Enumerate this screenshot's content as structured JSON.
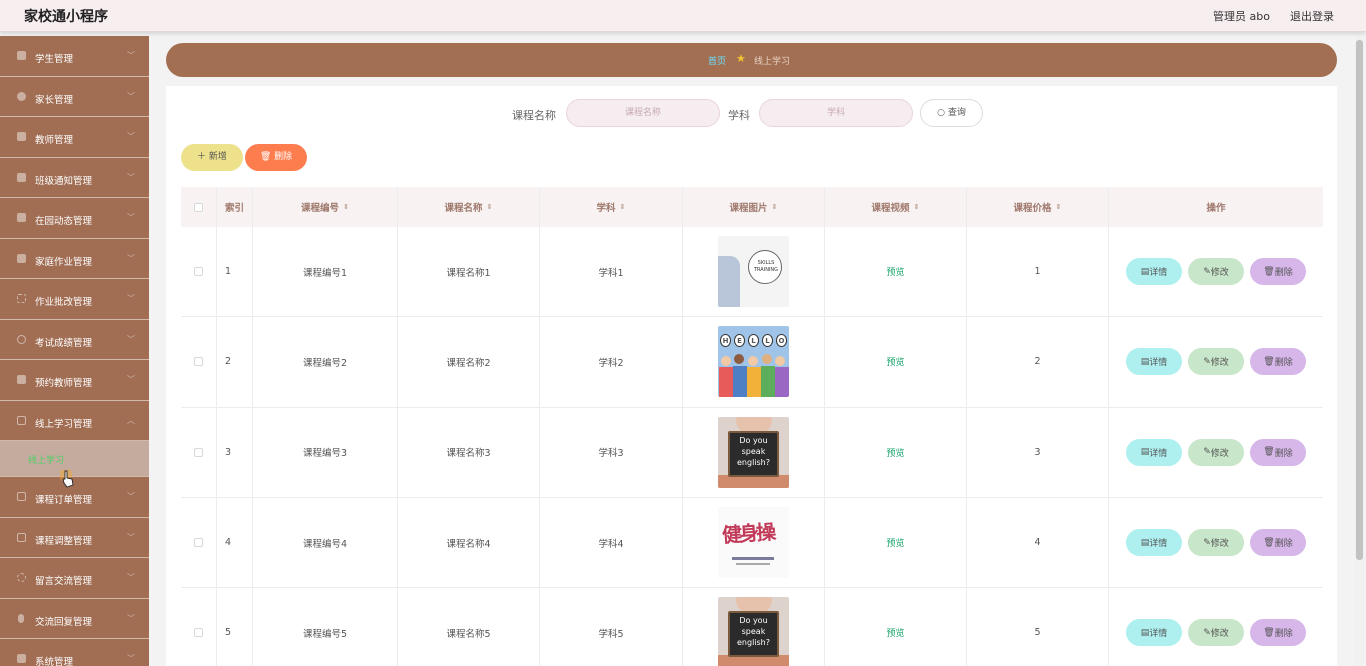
{
  "header": {
    "brand": "家校通小程序",
    "admin_label": "管理员 abo",
    "logout_label": "退出登录"
  },
  "sidebar": {
    "items": [
      {
        "label": "学生管理",
        "icon": "grid-icon"
      },
      {
        "label": "家长管理",
        "icon": "location-icon"
      },
      {
        "label": "教师管理",
        "icon": "chart-icon"
      },
      {
        "label": "班级通知管理",
        "icon": "notice-icon"
      },
      {
        "label": "在园动态管理",
        "icon": "building-icon"
      },
      {
        "label": "家庭作业管理",
        "icon": "puzzle-icon"
      },
      {
        "label": "作业批改管理",
        "icon": "expand-icon"
      },
      {
        "label": "考试成绩管理",
        "icon": "circle-icon"
      },
      {
        "label": "预约教师管理",
        "icon": "list-icon"
      },
      {
        "label": "线上学习管理",
        "icon": "mail-icon"
      }
    ],
    "active_sub": "线上学习",
    "items_after": [
      {
        "label": "课程订单管理",
        "icon": "order-icon"
      },
      {
        "label": "课程调整管理",
        "icon": "crop-icon"
      },
      {
        "label": "留言交流管理",
        "icon": "message-icon"
      },
      {
        "label": "交流回复管理",
        "icon": "mic-icon"
      },
      {
        "label": "系统管理",
        "icon": "settings-icon"
      }
    ]
  },
  "breadcrumb": {
    "home": "首页",
    "current": "线上学习"
  },
  "search": {
    "name_label": "课程名称",
    "name_placeholder": "课程名称",
    "subject_label": "学科",
    "subject_placeholder": "学科",
    "query_label": "查询"
  },
  "toolbar": {
    "add_label": "新增",
    "delete_label": "删除"
  },
  "table": {
    "headers": {
      "index": "索引",
      "code": "课程编号",
      "name": "课程名称",
      "subject": "学科",
      "image": "课程图片",
      "video": "课程视频",
      "price": "课程价格",
      "action": "操作"
    },
    "rows": [
      {
        "index": "1",
        "code": "课程编号1",
        "name": "课程名称1",
        "subject": "学科1",
        "video": "预览",
        "price": "1",
        "thumb": "skill-training"
      },
      {
        "index": "2",
        "code": "课程编号2",
        "name": "课程名称2",
        "subject": "学科2",
        "video": "预览",
        "price": "2",
        "thumb": "hello-kids"
      },
      {
        "index": "3",
        "code": "课程编号3",
        "name": "课程名称3",
        "subject": "学科3",
        "video": "预览",
        "price": "3",
        "thumb": "do-you-speak-english"
      },
      {
        "index": "4",
        "code": "课程编号4",
        "name": "课程名称4",
        "subject": "学科4",
        "video": "预览",
        "price": "4",
        "thumb": "jianshen-calligraphy"
      },
      {
        "index": "5",
        "code": "课程编号5",
        "name": "课程名称5",
        "subject": "学科5",
        "video": "预览",
        "price": "5",
        "thumb": "do-you-speak-english"
      }
    ],
    "actions": {
      "detail": "详情",
      "edit": "修改",
      "delete": "删除"
    },
    "thumb_text": {
      "skill": "SKILLS TRAINING",
      "hello": [
        "H",
        "E",
        "L",
        "L",
        "O"
      ],
      "english": [
        "Do you",
        "speak",
        "english?"
      ],
      "jianshen": "健身操"
    }
  },
  "colors": {
    "sidebar": "#a16e54",
    "breadcrumb": "#a36f53",
    "add_button": "#ede28b",
    "delete_button": "#fe7d4e",
    "detail_button": "#aeeff0",
    "edit_button": "#c8e6c9",
    "row_delete_button": "#d7b6ea",
    "preview_link": "#17a46a"
  }
}
